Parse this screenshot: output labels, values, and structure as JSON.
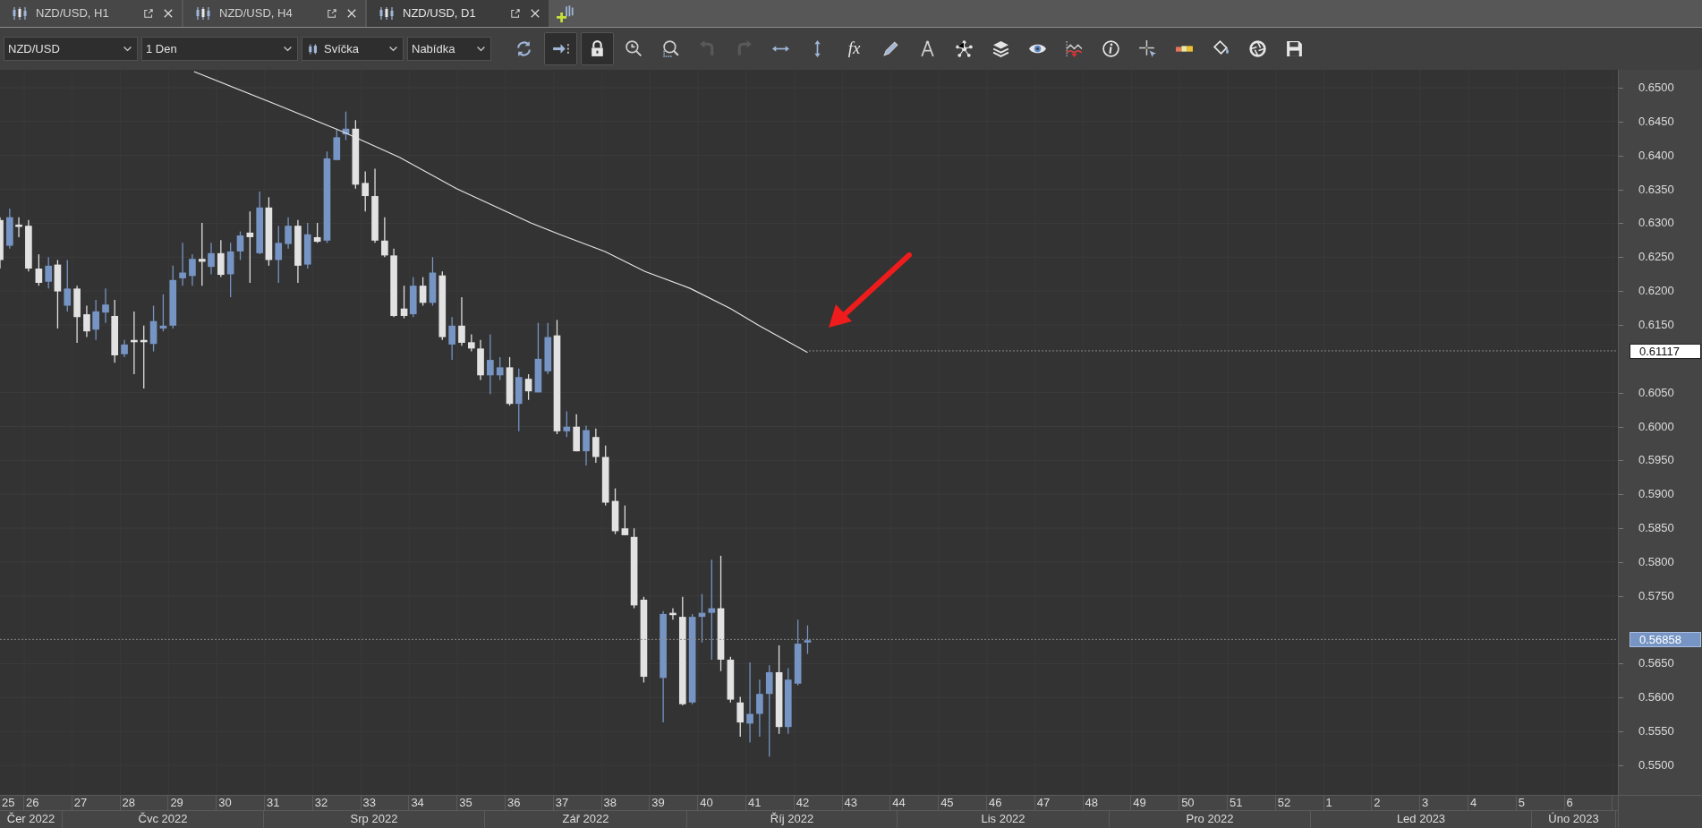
{
  "tabs": [
    {
      "label": "NZD/USD, H1",
      "selected": false
    },
    {
      "label": "NZD/USD, H4",
      "selected": false
    },
    {
      "label": "NZD/USD, D1",
      "selected": true
    }
  ],
  "toolbar": {
    "dropdowns": [
      {
        "kind": "symbol",
        "value": "NZD/USD"
      },
      {
        "kind": "period",
        "value": "1 Den"
      },
      {
        "kind": "chart-type",
        "value": "Svíčka"
      },
      {
        "kind": "price",
        "value": "Nabídka"
      }
    ],
    "buttons": [
      {
        "kind": "sync",
        "pressed": false,
        "disabled": false
      },
      {
        "kind": "shift",
        "pressed": true,
        "disabled": false
      },
      {
        "kind": "lock",
        "pressed": true,
        "disabled": false
      },
      {
        "kind": "zoom-time",
        "pressed": false,
        "disabled": false
      },
      {
        "kind": "zoom-area",
        "pressed": false,
        "disabled": false
      },
      {
        "kind": "undo",
        "pressed": false,
        "disabled": true
      },
      {
        "kind": "redo",
        "pressed": false,
        "disabled": true
      },
      {
        "kind": "hscale",
        "pressed": false,
        "disabled": false
      },
      {
        "kind": "vscale",
        "pressed": false,
        "disabled": false
      },
      {
        "kind": "fx",
        "label": "fx",
        "pressed": false,
        "disabled": false
      },
      {
        "kind": "pencil",
        "pressed": false,
        "disabled": false
      },
      {
        "kind": "compass",
        "pressed": false,
        "disabled": false
      },
      {
        "kind": "nodes",
        "pressed": false,
        "disabled": false
      },
      {
        "kind": "layers",
        "pressed": false,
        "disabled": false
      },
      {
        "kind": "eye",
        "pressed": false,
        "disabled": false
      },
      {
        "kind": "signal",
        "pressed": false,
        "disabled": false
      },
      {
        "kind": "info",
        "pressed": false,
        "disabled": false
      },
      {
        "kind": "crosshair",
        "pressed": false,
        "disabled": false
      },
      {
        "kind": "colors",
        "pressed": false,
        "disabled": false
      },
      {
        "kind": "bucket",
        "pressed": false,
        "disabled": false
      },
      {
        "kind": "aperture",
        "pressed": false,
        "disabled": false
      },
      {
        "kind": "save",
        "pressed": false,
        "disabled": false
      }
    ]
  },
  "price_axis": {
    "ticks": [
      "0.6500",
      "0.6450",
      "0.6400",
      "0.6350",
      "0.6300",
      "0.6250",
      "0.6200",
      "0.6150",
      "0.6050",
      "0.6000",
      "0.5950",
      "0.5900",
      "0.5850",
      "0.5800",
      "0.5750",
      "0.5650",
      "0.5600",
      "0.5550",
      "0.5500"
    ],
    "markers": [
      {
        "kind": "line",
        "text": "0.61117"
      },
      {
        "kind": "bid",
        "text": "0.56858"
      }
    ]
  },
  "time_axis": {
    "weeks": [
      "25",
      "26",
      "27",
      "28",
      "29",
      "30",
      "31",
      "32",
      "33",
      "34",
      "35",
      "36",
      "37",
      "38",
      "39",
      "40",
      "41",
      "42",
      "43",
      "44",
      "45",
      "46",
      "47",
      "48",
      "49",
      "50",
      "51",
      "52",
      "1",
      "2",
      "3",
      "4",
      "5",
      "6"
    ],
    "months": [
      "Čer 2022",
      "Čvc 2022",
      "Srp 2022",
      "Zář 2022",
      "Říj 2022",
      "Lis 2022",
      "Pro 2022",
      "Led 2023",
      "Úno 2023"
    ]
  }
}
